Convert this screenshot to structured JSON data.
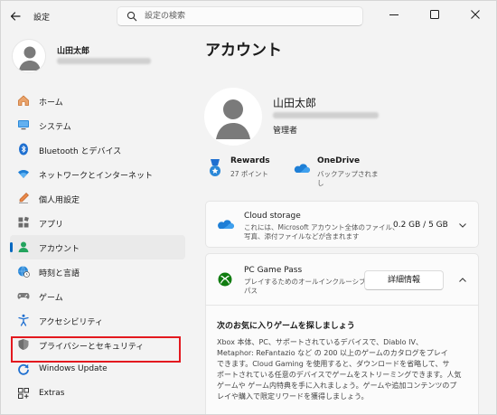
{
  "app": {
    "title": "設定"
  },
  "search": {
    "placeholder": "設定の検索"
  },
  "profile": {
    "name": "山田太郎"
  },
  "sidebar": {
    "items": [
      {
        "label": "ホーム",
        "icon": "home-icon"
      },
      {
        "label": "システム",
        "icon": "monitor-icon"
      },
      {
        "label": "Bluetooth とデバイス",
        "icon": "bluetooth-icon"
      },
      {
        "label": "ネットワークとインターネット",
        "icon": "wifi-icon"
      },
      {
        "label": "個人用設定",
        "icon": "pen-icon"
      },
      {
        "label": "アプリ",
        "icon": "apps-icon"
      },
      {
        "label": "アカウント",
        "icon": "person-icon",
        "active": true
      },
      {
        "label": "時刻と言語",
        "icon": "globe-clock-icon"
      },
      {
        "label": "ゲーム",
        "icon": "gamepad-icon"
      },
      {
        "label": "アクセシビリティ",
        "icon": "accessibility-icon"
      },
      {
        "label": "プライバシーとセキュリティ",
        "icon": "shield-icon",
        "highlighted": true
      },
      {
        "label": "Windows Update",
        "icon": "refresh-icon"
      },
      {
        "label": "Extras",
        "icon": "extras-icon"
      }
    ]
  },
  "main": {
    "title": "アカウント",
    "account": {
      "name": "山田太郎",
      "role": "管理者"
    },
    "rewards": {
      "title": "Rewards",
      "points": "27 ポイント"
    },
    "onedrive": {
      "title": "OneDrive",
      "status_line1": "バックアップされま",
      "status_line2": "し"
    },
    "cloud_storage": {
      "title": "Cloud storage",
      "desc_line1": "これには、Microsoft アカウント全体のファイル、",
      "desc_line2": "写真、添付ファイルなどが含まれます",
      "value": "0.2 GB / 5 GB"
    },
    "game_pass": {
      "title": "PC Game Pass",
      "desc_line1": "プレイするためのオールインクルーシブ",
      "desc_line2": "パス",
      "button": "詳細情報",
      "fav_title": "次のお気に入りゲームを探しましょう",
      "body_lines": [
        "Xbox 本体、PC、サポートされているデバイスで、Diablo IV、",
        "Metaphor: ReFantazio など の 200 以上のゲームのカタログをプレイ",
        "できます。Cloud Gaming を使用すると、ダウンロードを省略して、サ",
        "ポートされている任意のデバイスでゲームをストリーミングできます。人気",
        "ゲームや ゲーム内特典を手に入れましょう。ゲームや追加コンテンツのプ",
        "レイや購入で限定リワードを獲得しましょう。"
      ]
    }
  },
  "colors": {
    "accent": "#0067c0",
    "highlight": "#e3191f",
    "xbox": "#107c10"
  }
}
